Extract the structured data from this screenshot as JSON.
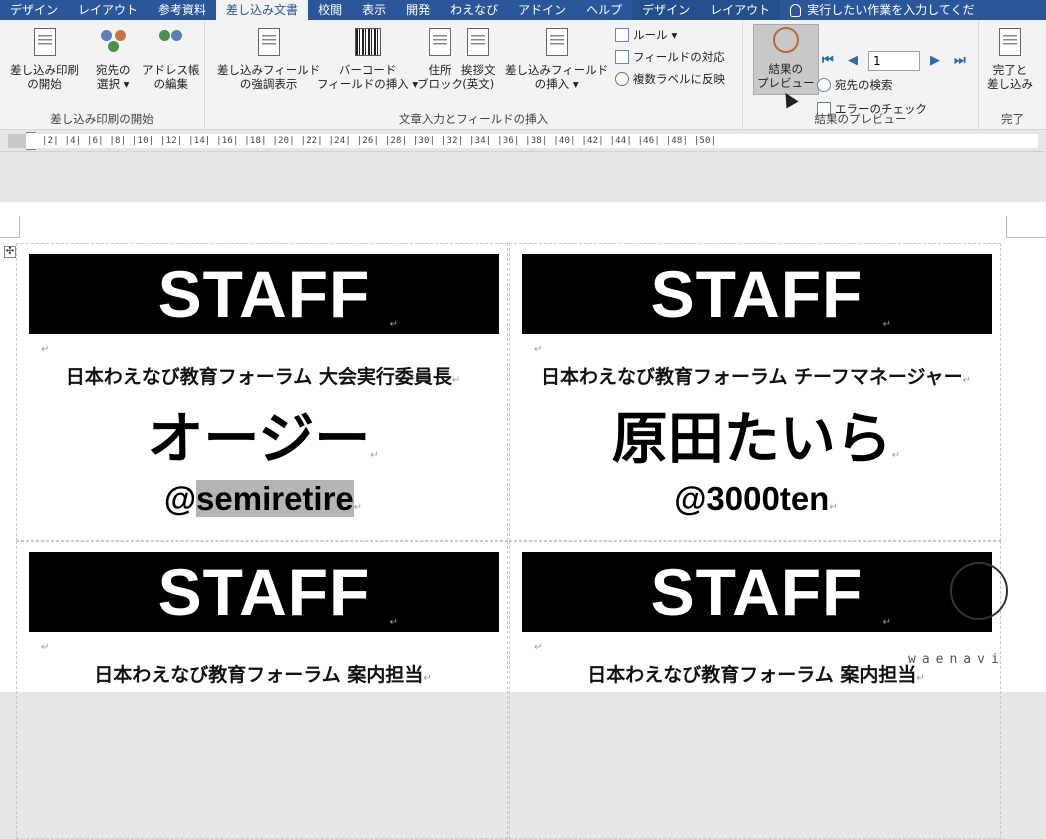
{
  "tabs": [
    {
      "label": "デザイン",
      "active": false
    },
    {
      "label": "レイアウト",
      "active": false
    },
    {
      "label": "参考資料",
      "active": false
    },
    {
      "label": "差し込み文書",
      "active": true
    },
    {
      "label": "校閲",
      "active": false
    },
    {
      "label": "表示",
      "active": false
    },
    {
      "label": "開発",
      "active": false
    },
    {
      "label": "わえなび",
      "active": false
    },
    {
      "label": "アドイン",
      "active": false
    },
    {
      "label": "ヘルプ",
      "active": false
    },
    {
      "label": "デザイン",
      "active": false
    },
    {
      "label": "レイアウト",
      "active": false
    }
  ],
  "tell_me": "実行したい作業を入力してくだ",
  "ribbon": {
    "groups": {
      "start": {
        "label": "差し込み印刷の開始",
        "buttons": {
          "start_merge": [
            "差し込み印刷",
            "の開始"
          ],
          "select_recipients": [
            "宛先の",
            "選択"
          ],
          "edit_list": [
            "アドレス帳",
            "の編集"
          ]
        }
      },
      "write": {
        "label": "文章入力とフィールドの挿入",
        "buttons": {
          "highlight": [
            "差し込みフィールド",
            "の強調表示"
          ],
          "barcode": [
            "バーコード",
            "フィールドの挿入"
          ],
          "address": [
            "住所",
            "ブロック"
          ],
          "greeting": [
            "挨拶文",
            "(英文)"
          ],
          "insert_field": [
            "差し込みフィールド",
            "の挿入"
          ],
          "rules": "ルール",
          "match_fields": "フィールドの対応",
          "update_labels": "複数ラベルに反映"
        }
      },
      "preview": {
        "label": "結果のプレビュー",
        "buttons": {
          "preview_results": [
            "結果の",
            "プレビュー"
          ],
          "record_number": "1",
          "find_recipient": "宛先の検索",
          "check_errors": "エラーのチェック"
        }
      },
      "finish": {
        "label": "完了",
        "buttons": {
          "finish_merge": [
            "完了と",
            "差し込み"
          ]
        }
      }
    }
  },
  "ruler_text": "|2| |4| |6| |8| |10| |12| |14| |16| |18| |20| |22| |24| |26| |28| |30| |32| |34| |36| |38| |40| |42| |44| |46| |48| |50|",
  "labels": [
    {
      "banner": "STAFF",
      "role": "日本わえなび教育フォーラム 大会実行委員長",
      "name": "オージー",
      "handle_prefix": "@",
      "handle_highlight": "semiretire"
    },
    {
      "banner": "STAFF",
      "role": "日本わえなび教育フォーラム チーフマネージャー",
      "name": "原田たいら",
      "handle_prefix": "@3000ten",
      "handle_highlight": ""
    },
    {
      "banner": "STAFF",
      "role": "日本わえなび教育フォーラム 案内担当"
    },
    {
      "banner": "STAFF",
      "role": "日本わえなび教育フォーラム 案内担当"
    }
  ],
  "paragraph_mark": "↵",
  "watermark": "waenavi"
}
